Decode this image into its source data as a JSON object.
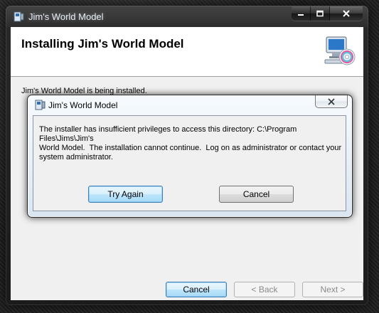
{
  "main_window": {
    "title": "Jim's World Model",
    "header_title": "Installing Jim's World Model",
    "status": "Jim's World Model is being installed.",
    "buttons": {
      "cancel": "Cancel",
      "back": "< Back",
      "next": "Next >"
    },
    "icons": {
      "app": "installer-icon",
      "header": "computer-cd-icon",
      "minimize": "minimize-icon",
      "maximize": "maximize-icon",
      "close": "close-icon"
    }
  },
  "dialog": {
    "title": "Jim's World Model",
    "message": "The installer has insufficient privileges to access this directory: C:\\Program Files\\Jims\\Jim's\nWorld Model.  The installation cannot continue.  Log on as administrator or contact your\nsystem administrator.",
    "buttons": {
      "retry": "Try Again",
      "cancel": "Cancel"
    },
    "icons": {
      "app": "installer-icon",
      "close": "close-icon"
    }
  },
  "colors": {
    "default_button": "#3c7fb1",
    "window_body": "#f0f0f0"
  }
}
